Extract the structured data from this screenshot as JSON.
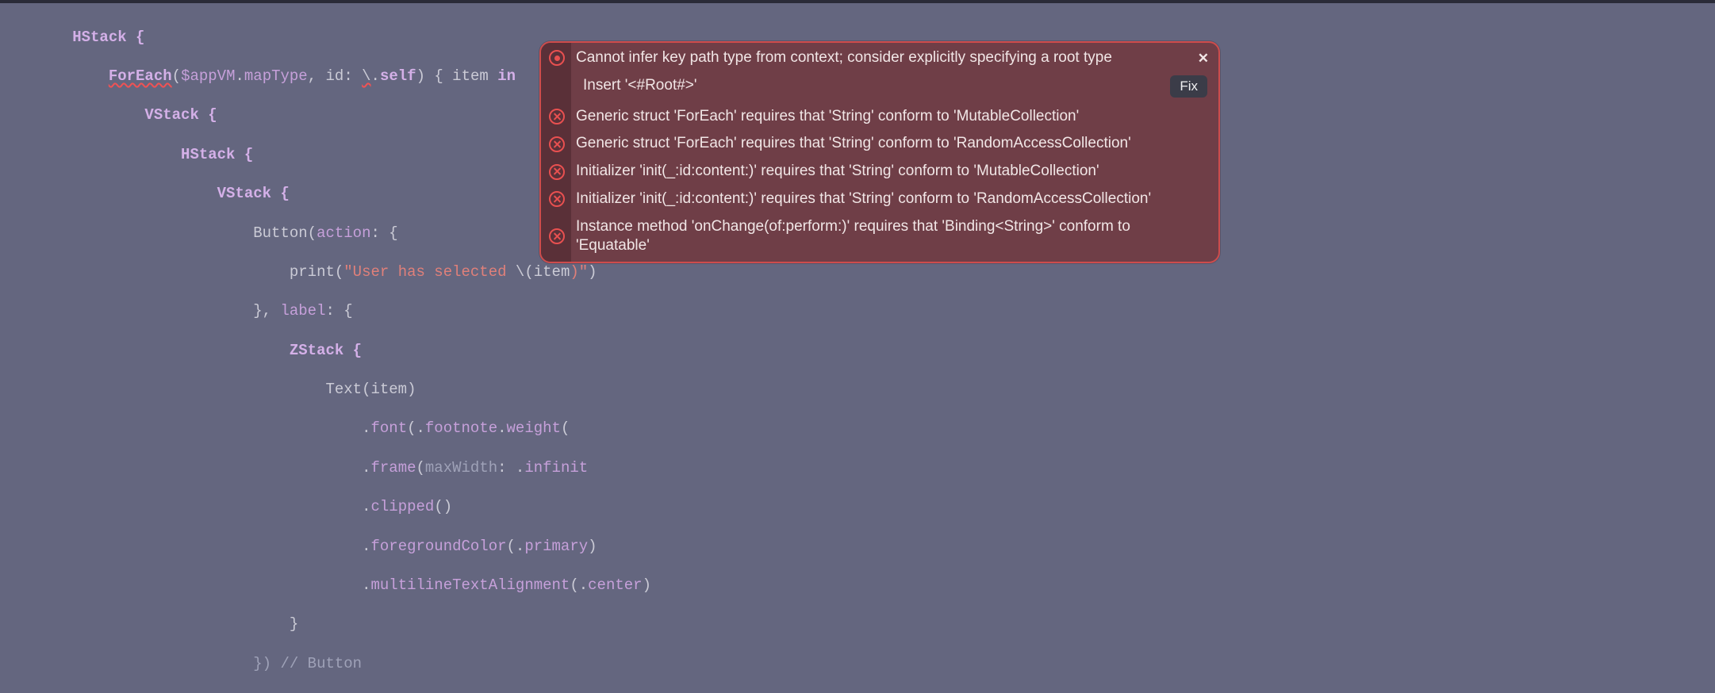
{
  "code": {
    "line1": "        HStack {",
    "line2a": "            ",
    "line2b": "ForEach",
    "line2c": "(",
    "line2d": "$appVM",
    "line2e": ".",
    "line2f": "mapType",
    "line2g": ", id: ",
    "line2h": "\\",
    "line2i": ".",
    "line2j": "self",
    "line2k": ") { item ",
    "line2l": "in",
    "line3": "                VStack {",
    "line4": "                    HStack {",
    "line5": "                        VStack {",
    "line6a": "                            Button(",
    "line6b": "action",
    "line6c": ": {",
    "line7a": "                                print(",
    "line7b": "\"User has selected ",
    "line7c": "\\(",
    "line7d": "item",
    "line7e": ")\"",
    "line7f": ")",
    "line8a": "                            }, ",
    "line8b": "label",
    "line8c": ": {",
    "line9": "                                ZStack {",
    "line10a": "                                    Text(item)",
    "line11a": "                                        .",
    "line11b": "font",
    "line11c": "(.",
    "line11d": "footnote",
    "line11e": ".",
    "line11f": "weight",
    "line11g": "(",
    "line12a": "                                        .",
    "line12b": "frame",
    "line12c": "(",
    "line12d": "maxWidth",
    "line12e": ": .",
    "line12f": "infinit",
    "line13a": "                                        .",
    "line13b": "clipped",
    "line13c": "()",
    "line14a": "                                        .",
    "line14b": "foregroundColor",
    "line14c": "(.",
    "line14d": "primary",
    "line14e": ")",
    "line15a": "                                        .",
    "line15b": "multilineTextAlignment",
    "line15c": "(.",
    "line15d": "center",
    "line15e": ")",
    "line16": "                                }",
    "line17": "                            }) // Button"
  },
  "errors": {
    "e1": "Cannot infer key path type from context; consider explicitly specifying a root type",
    "fixText": "Insert '<#Root#>'",
    "fixBtn": "Fix",
    "e2": "Generic struct 'ForEach' requires that 'String' conform to 'MutableCollection'",
    "e3": "Generic struct 'ForEach' requires that 'String' conform to 'RandomAccessCollection'",
    "e4": "Initializer 'init(_:id:content:)' requires that 'String' conform to 'MutableCollection'",
    "e5": "Initializer 'init(_:id:content:)' requires that 'String' conform to 'RandomAccessCollection'",
    "e6": "Instance method 'onChange(of:perform:)' requires that 'Binding<String>' conform to 'Equatable'"
  }
}
